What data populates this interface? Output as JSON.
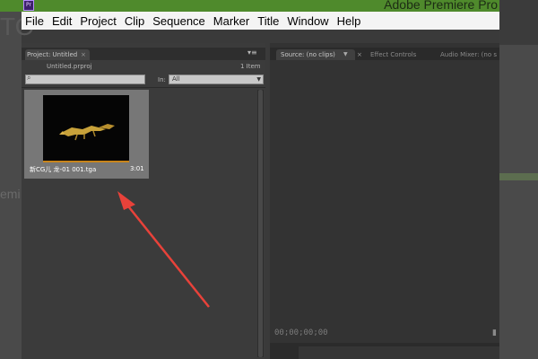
{
  "window": {
    "title": "Adobe Premiere Pro",
    "icon": "Pr"
  },
  "menubar": {
    "items": [
      "File",
      "Edit",
      "Project",
      "Clip",
      "Sequence",
      "Marker",
      "Title",
      "Window",
      "Help"
    ]
  },
  "background": {
    "left_text1": "TO",
    "left_text2": "emi"
  },
  "project_panel": {
    "tab_label": "Project: Untitled",
    "tab_close": "×",
    "menu_icon": "▾≡",
    "file_name": "Untitled.prproj",
    "item_count": "1 Item",
    "search_placeholder": "",
    "in_label": "In:",
    "in_value": "All",
    "clip": {
      "name": "新CG儿 龙-01 001.tga",
      "duration": "3:01"
    }
  },
  "source_panel": {
    "tab_label": "Source: (no clips)",
    "tab_close": "×",
    "effect_controls_tab": "Effect Controls",
    "audio_mixer_tab": "Audio Mixer: (no s",
    "timecode": "00;00;00;00"
  },
  "colors": {
    "title_bar": "#4f8a2c",
    "panel_bg": "#3b3b3b",
    "arrow": "#e8423a",
    "thumb_orange": "#c8841a"
  }
}
